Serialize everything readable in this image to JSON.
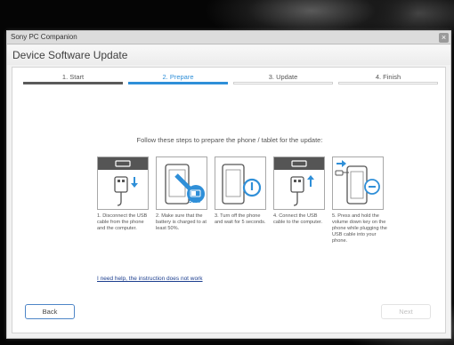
{
  "window": {
    "app_title": "Sony PC Companion",
    "close_glyph": "×",
    "page_title": "Device Software Update"
  },
  "steps": [
    {
      "label": "1. Start",
      "state": "done"
    },
    {
      "label": "2. Prepare",
      "state": "active"
    },
    {
      "label": "3. Update",
      "state": "pending"
    },
    {
      "label": "4. Finish",
      "state": "pending"
    }
  ],
  "instruction": "Follow these steps to prepare the phone / tablet for the update:",
  "cards": [
    {
      "icon": "usb-disconnect-icon",
      "text": "1. Disconnect the USB cable from the phone and the computer."
    },
    {
      "icon": "battery-icon",
      "badge": "50%",
      "text": "2. Make sure that the battery is charged to at least 50%."
    },
    {
      "icon": "power-off-icon",
      "text": "3. Turn off the phone and wait for 5 seconds."
    },
    {
      "icon": "usb-connect-icon",
      "text": "4. Connect the USB cable to the computer."
    },
    {
      "icon": "volume-down-icon",
      "text": "5. Press and hold the volume down key on the phone while plugging the USB cable into your phone."
    }
  ],
  "help_link": "I need help, the instruction does not work",
  "buttons": {
    "back": "Back",
    "next": "Next"
  },
  "colors": {
    "accent": "#2f8fd8",
    "dark": "#555555"
  }
}
